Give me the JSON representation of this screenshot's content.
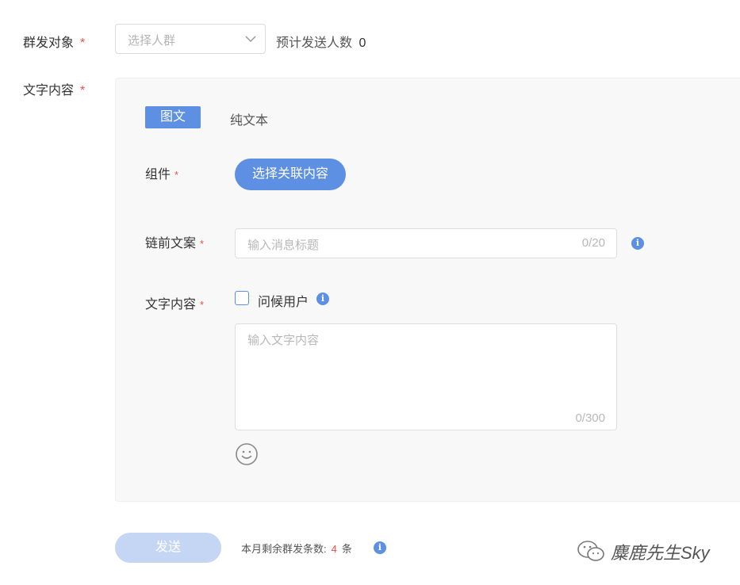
{
  "form": {
    "audience_label": "群发对象",
    "required_mark": "*",
    "audience_select_placeholder": "选择人群",
    "estimate_label": "预计发送人数",
    "estimate_count": "0",
    "text_content_label": "文字内容"
  },
  "panel": {
    "tabs": [
      {
        "label": "图文",
        "active": true
      },
      {
        "label": "纯文本",
        "active": false
      }
    ],
    "component_label": "组件",
    "select_content_button": "选择关联内容",
    "link_copy_label": "链前文案",
    "link_copy_placeholder": "输入消息标题",
    "link_copy_counter": "0/20",
    "text_label": "文字内容",
    "greet_user_label": "问候用户",
    "text_placeholder": "输入文字内容",
    "text_counter": "0/300"
  },
  "footer": {
    "send_button": "发送",
    "remaining_prefix": "本月剩余群发条数:",
    "remaining_count": "4",
    "remaining_unit": "条"
  },
  "watermark": {
    "text": "麋鹿先生Sky"
  },
  "colors": {
    "accent": "#5d8fe3",
    "required": "#e8504b",
    "disabled_button": "#c5d6f4"
  }
}
